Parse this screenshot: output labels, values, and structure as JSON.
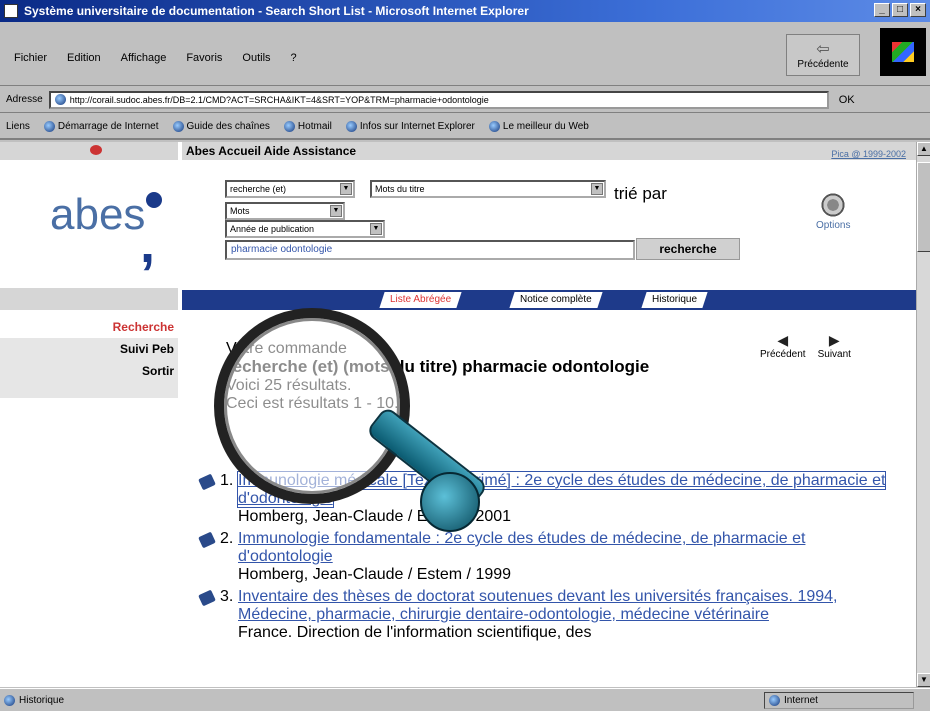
{
  "window": {
    "title": "Système universitaire de documentation - Search Short List - Microsoft Internet Explorer"
  },
  "menu": [
    "Fichier",
    "Edition",
    "Affichage",
    "Favoris",
    "Outils",
    "?"
  ],
  "toolbar": {
    "back_label": "Précédente"
  },
  "address": {
    "label": "Adresse",
    "url": "http://corail.sudoc.abes.fr/DB=2.1/CMD?ACT=SRCHA&IKT=4&SRT=YOP&TRM=pharmacie+odontologie",
    "go_label": "OK"
  },
  "links": {
    "label": "Liens",
    "items": [
      "Démarrage de Internet",
      "Guide des chaînes",
      "Hotmail",
      "Infos sur Internet Explorer",
      "Le meilleur du Web"
    ]
  },
  "sidebar": {
    "logo_text": "abes",
    "items": [
      {
        "label": "Recherche",
        "active": true
      },
      {
        "label": "Suivi Peb"
      },
      {
        "label": "Sortir"
      }
    ]
  },
  "header": {
    "nav": "Abes  Accueil  Aide  Assistance",
    "copyright": "Pica @ 1999-2002"
  },
  "search": {
    "combo1": "recherche (et)",
    "field1": "Mots du titre",
    "combo2": "Mots",
    "sort_field": "Année de publication",
    "sort_label": "trié par",
    "query": "pharmacie odontologie",
    "button": "recherche",
    "options_label": "Options"
  },
  "tabs": [
    {
      "label": "Liste Abrégée",
      "current": true
    },
    {
      "label": "Notice complète"
    },
    {
      "label": "Historique"
    }
  ],
  "pager": {
    "prev": "Précédent",
    "next": "Suivant"
  },
  "order": {
    "line1": "Votre commande",
    "query_text": "recherche (et) (mots du titre) pharmacie odontologie",
    "count": "Voici 25 résultats.",
    "range": "Ceci est résultats 1 - 10."
  },
  "results": [
    {
      "num": "1.",
      "title": "Immunologie médicale [Texte imprimé] : 2e cycle des études de médecine, de pharmacie et d'odontologie",
      "meta": "Homberg, Jean-Claude / Estem / 2001"
    },
    {
      "num": "2.",
      "title": "Immunologie fondamentale : 2e cycle des études de médecine, de pharmacie et d'odontologie",
      "meta": "Homberg, Jean-Claude / Estem / 1999"
    },
    {
      "num": "3.",
      "title": "Inventaire des thèses de doctorat soutenues devant les universités françaises. 1994, Médecine, pharmacie, chirurgie dentaire-odontologie, médecine vétérinaire",
      "meta": "France. Direction de l'information scientifique, des"
    }
  ],
  "status": {
    "left": "Historique",
    "zone": "Internet"
  }
}
